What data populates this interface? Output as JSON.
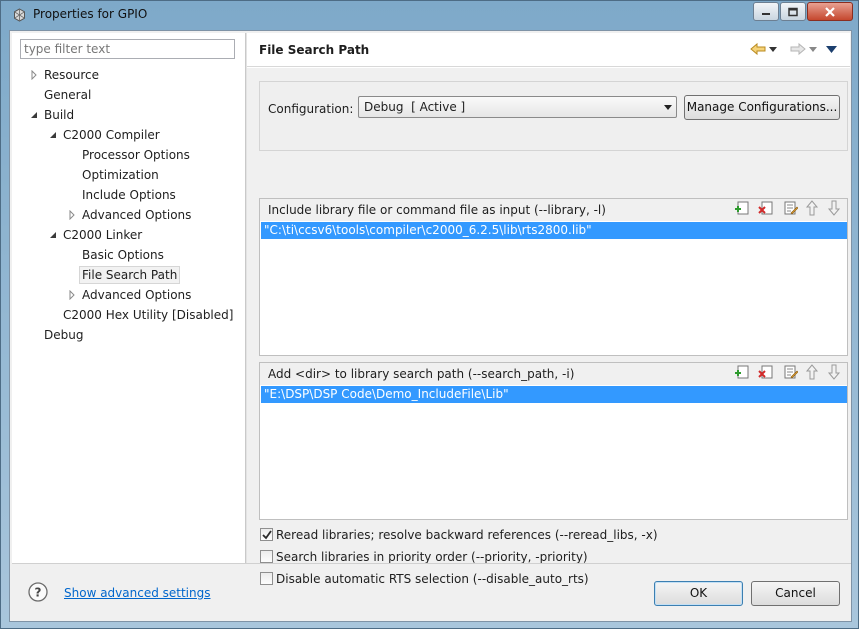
{
  "window": {
    "title": "Properties for GPIO"
  },
  "filter": {
    "placeholder": "type filter text"
  },
  "tree": {
    "items": [
      {
        "label": "Resource",
        "expander": "collapsed"
      },
      {
        "label": "General",
        "expander": "none"
      },
      {
        "label": "Build",
        "expander": "expanded"
      },
      {
        "label": "C2000 Compiler",
        "expander": "expanded"
      },
      {
        "label": "Processor Options",
        "expander": "none"
      },
      {
        "label": "Optimization",
        "expander": "none"
      },
      {
        "label": "Include Options",
        "expander": "none"
      },
      {
        "label": "Advanced Options",
        "expander": "collapsed"
      },
      {
        "label": "C2000 Linker",
        "expander": "expanded"
      },
      {
        "label": "Basic Options",
        "expander": "none"
      },
      {
        "label": "File Search Path",
        "expander": "none",
        "selected": true
      },
      {
        "label": "Advanced Options",
        "expander": "collapsed"
      },
      {
        "label": "C2000 Hex Utility  [Disabled]",
        "expander": "none"
      },
      {
        "label": "Debug",
        "expander": "none"
      }
    ]
  },
  "page": {
    "title": "File Search Path"
  },
  "configuration": {
    "label": "Configuration:",
    "selected": "Debug  [ Active ]",
    "manage_button": "Manage Configurations..."
  },
  "include_list": {
    "title": "Include library file or command file as input (--library, -l)",
    "items": [
      "\"C:\\ti\\ccsv6\\tools\\compiler\\c2000_6.2.5\\lib\\rts2800.lib\""
    ]
  },
  "search_path_list": {
    "title": "Add <dir> to library search path (--search_path, -i)",
    "items": [
      "\"E:\\DSP\\DSP Code\\Demo_IncludeFile\\Lib\""
    ]
  },
  "options": {
    "reread": {
      "label": "Reread libraries; resolve backward references (--reread_libs, -x)",
      "checked": true
    },
    "priority": {
      "label": "Search libraries in priority order (--priority, -priority)",
      "checked": false
    },
    "disable_rts": {
      "label": "Disable automatic RTS selection (--disable_auto_rts)",
      "checked": false
    }
  },
  "footer": {
    "advanced_link": "Show advanced settings",
    "ok_button": "OK",
    "cancel_button": "Cancel"
  },
  "colors": {
    "selection": "#3399ff",
    "link": "#0066cc",
    "titlebar": "#a9c6dc"
  }
}
